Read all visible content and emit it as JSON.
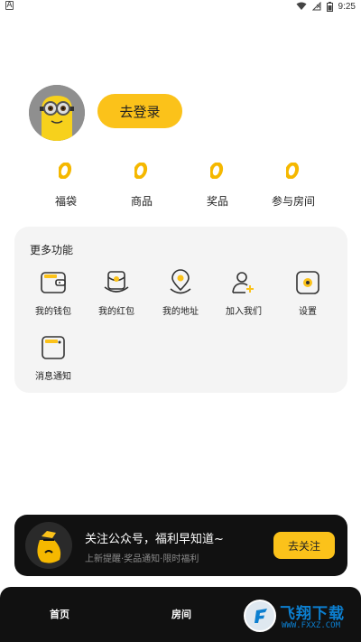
{
  "status_bar": {
    "left_badge": "A",
    "time": "9:25"
  },
  "profile": {
    "login_label": "去登录"
  },
  "stats": [
    {
      "value": "0",
      "label": "福袋"
    },
    {
      "value": "0",
      "label": "商品"
    },
    {
      "value": "0",
      "label": "奖品"
    },
    {
      "value": "0",
      "label": "参与房间"
    }
  ],
  "more": {
    "title": "更多功能",
    "items": [
      {
        "label": "我的钱包",
        "icon": "wallet-icon"
      },
      {
        "label": "我的红包",
        "icon": "red-packet-icon"
      },
      {
        "label": "我的地址",
        "icon": "location-icon"
      },
      {
        "label": "加入我们",
        "icon": "add-user-icon"
      },
      {
        "label": "设置",
        "icon": "settings-icon"
      },
      {
        "label": "消息通知",
        "icon": "notification-icon"
      }
    ]
  },
  "follow": {
    "title": "关注公众号，福利早知道~",
    "subtitle": "上新提醒·奖品通知·限时福利",
    "button": "去关注"
  },
  "nav": {
    "home": "首页",
    "room": "房间"
  },
  "watermark": {
    "text": "飞翔下载",
    "url": "WWW.FXXZ.COM"
  },
  "colors": {
    "accent": "#fbc21a",
    "dark": "#111111",
    "card": "#f4f4f4"
  }
}
